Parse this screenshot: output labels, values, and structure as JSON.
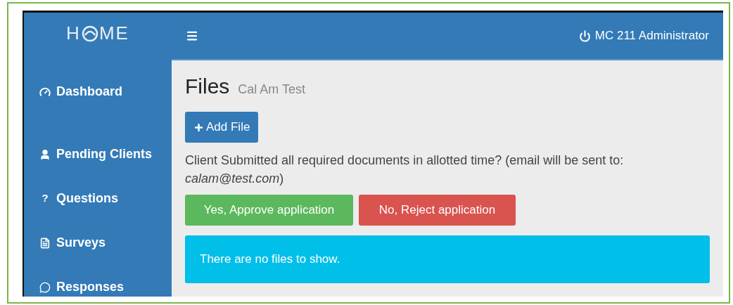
{
  "logo": {
    "before": "H",
    "after": "ME"
  },
  "header": {
    "user": "MC 211 Administrator"
  },
  "sidebar": {
    "items": [
      {
        "label": "Dashboard"
      },
      {
        "label": "Pending Clients"
      },
      {
        "label": "Questions",
        "glyph": "?"
      },
      {
        "label": "Surveys"
      },
      {
        "label": "Responses"
      }
    ]
  },
  "page": {
    "title": "Files",
    "subtitle": "Cal Am Test",
    "add_button": "Add File",
    "prompt": "Client Submitted all required documents in allotted time? (email will be sent to: *calam@test.com*)",
    "approve_button": "Yes, Approve application",
    "reject_button": "No, Reject application",
    "notice": "There are no files to show."
  }
}
